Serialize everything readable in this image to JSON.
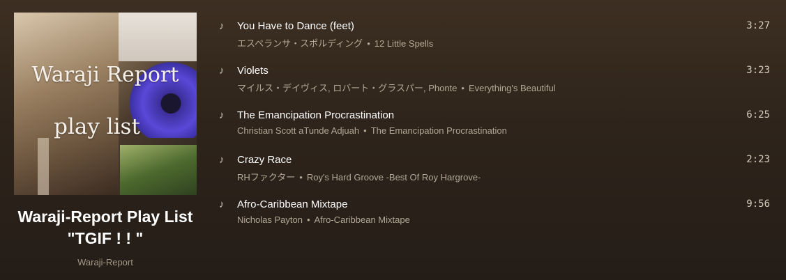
{
  "playlist": {
    "cover_line1": "Waraji Report",
    "cover_line2": "play list",
    "title": "Waraji-Report Play List \"TGIF ! ! \"",
    "owner": "Waraji-Report"
  },
  "separator": "•",
  "tracks": [
    {
      "name": "You Have to Dance (feet)",
      "artists": "エスペランサ・スポルディング",
      "album": "12 Little Spells",
      "duration": "3:27",
      "icon": "music-note-icon"
    },
    {
      "name": "Violets",
      "artists": "マイルス・デイヴィス, ロバート・グラスパー, Phonte",
      "album": "Everything's Beautiful",
      "duration": "3:23",
      "icon": "music-note-icon"
    },
    {
      "name": "The Emancipation Procrastination",
      "artists": "Christian Scott aTunde Adjuah",
      "album": "The Emancipation Procrastination",
      "duration": "6:25",
      "icon": "music-note-icon"
    },
    {
      "name": "Crazy Race",
      "artists": "RHファクター",
      "album": "Roy's Hard Groove -Best Of Roy Hargrove-",
      "duration": "2:23",
      "icon": "music-note-icon"
    },
    {
      "name": "Afro-Caribbean Mixtape",
      "artists": "Nicholas Payton",
      "album": "Afro-Caribbean Mixtape",
      "duration": "9:56",
      "icon": "music-note-icon"
    }
  ]
}
